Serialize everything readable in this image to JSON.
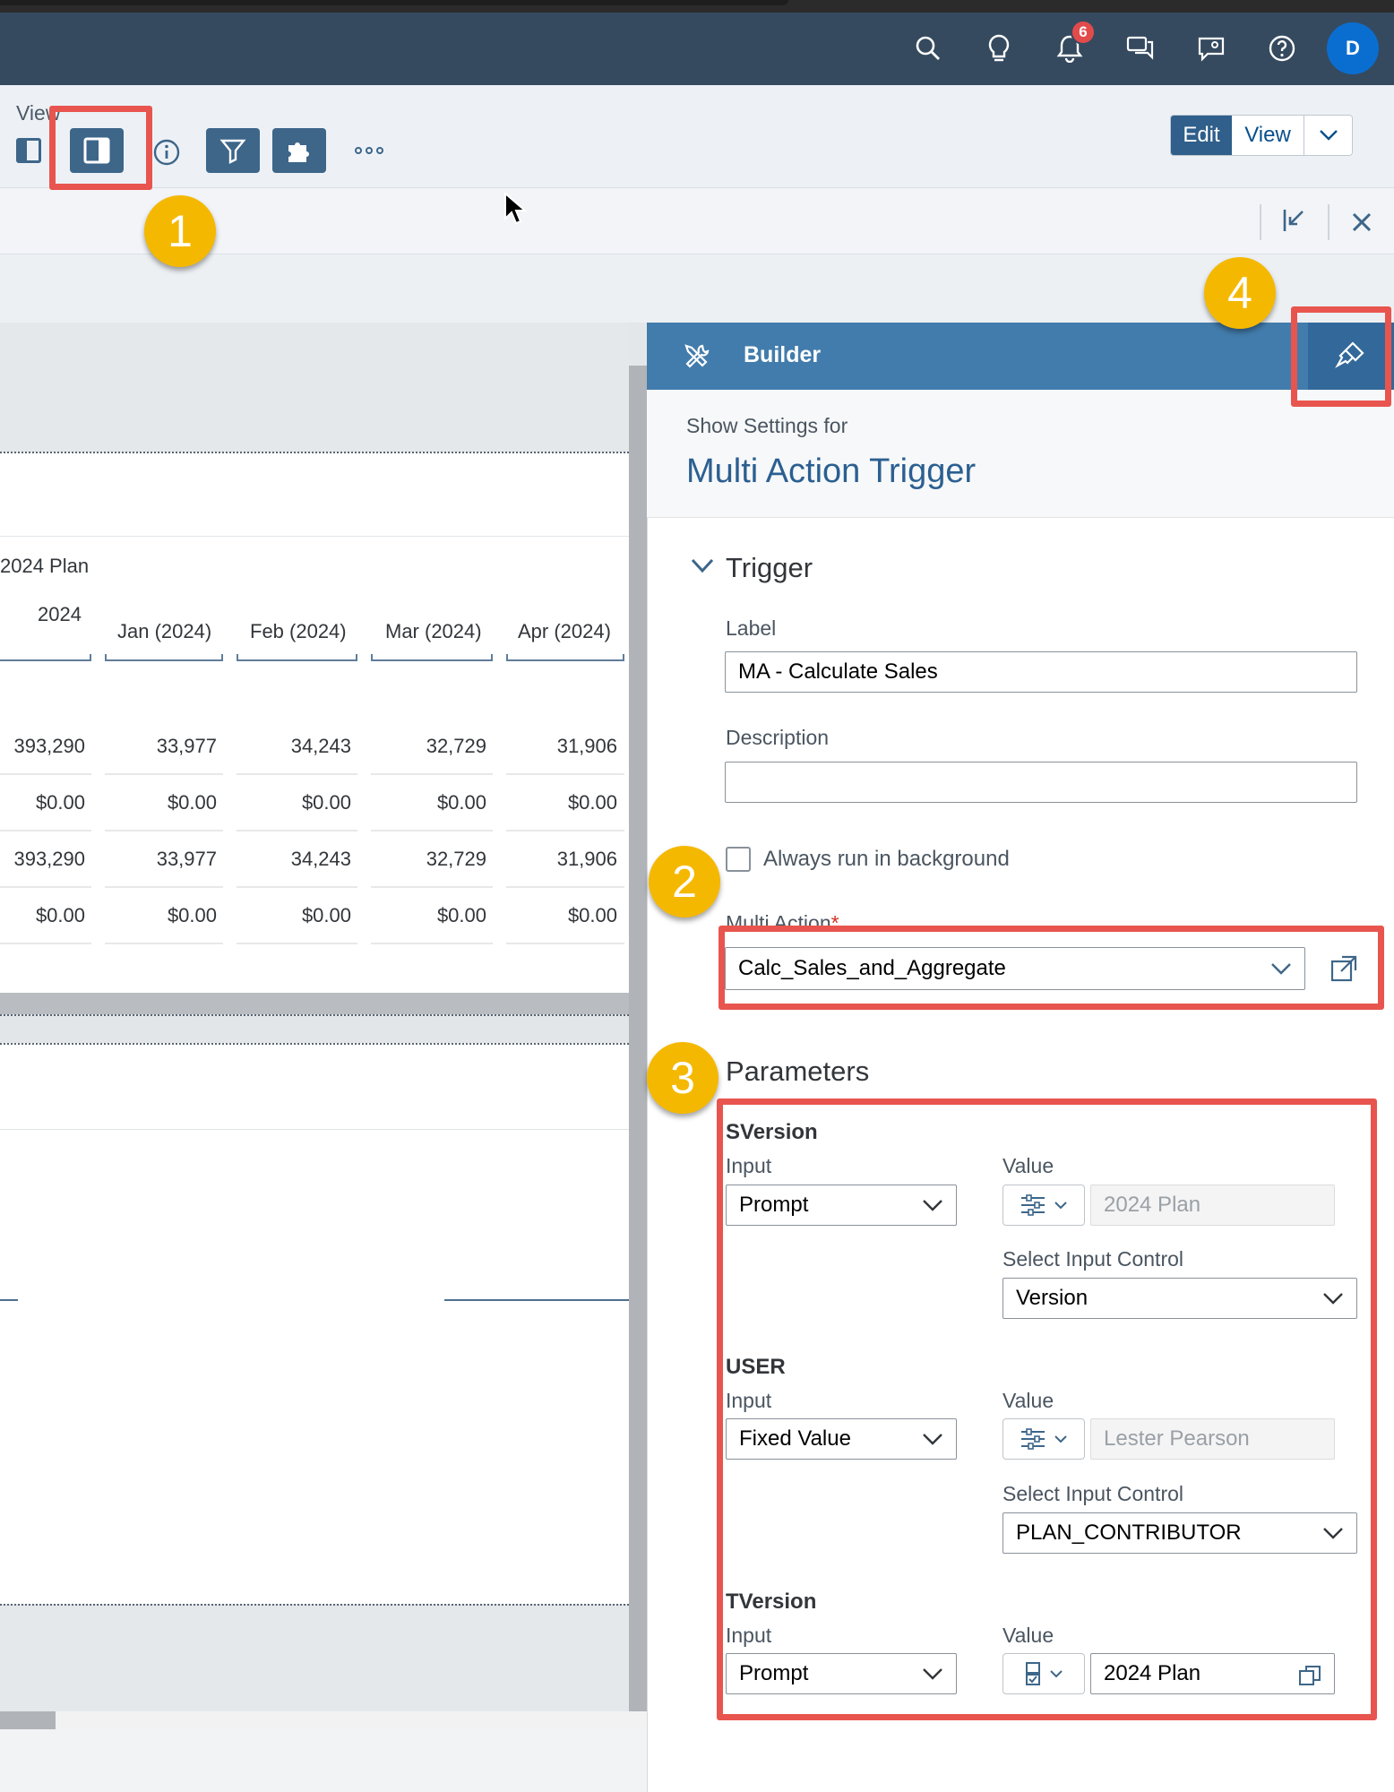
{
  "shell": {
    "notification_count": "6",
    "avatar_initial": "D"
  },
  "toolbar": {
    "view_label": "View",
    "edit_label": "Edit",
    "view_btn_label": "View"
  },
  "table": {
    "version_label": "2024 Plan",
    "columns": [
      "2024",
      "Jan (2024)",
      "Feb (2024)",
      "Mar (2024)",
      "Apr (2024)"
    ],
    "rows": [
      [
        "393,290",
        "33,977",
        "34,243",
        "32,729",
        "31,906"
      ],
      [
        "$0.00",
        "$0.00",
        "$0.00",
        "$0.00",
        "$0.00"
      ],
      [
        "393,290",
        "33,977",
        "34,243",
        "32,729",
        "31,906"
      ],
      [
        "$0.00",
        "$0.00",
        "$0.00",
        "$0.00",
        "$0.00"
      ]
    ]
  },
  "builder": {
    "title": "Builder",
    "show_settings_for": "Show Settings for",
    "object_name": "Multi Action Trigger",
    "trigger_section": "Trigger",
    "label_field": "Label",
    "label_value": "MA - Calculate Sales",
    "description_field": "Description",
    "description_value": "",
    "always_bg": "Always run in background",
    "multi_action_label": "Multi Action",
    "multi_action_required": "*",
    "multi_action_value": "Calc_Sales_and_Aggregate",
    "parameters_section": "Parameters",
    "params": [
      {
        "name": "SVersion",
        "input_label": "Input",
        "input_value": "Prompt",
        "value_label": "Value",
        "value_text": "2024 Plan",
        "select_ic_label": "Select Input Control",
        "select_ic_value": "Version"
      },
      {
        "name": "USER",
        "input_label": "Input",
        "input_value": "Fixed Value",
        "value_label": "Value",
        "value_text": "Lester Pearson",
        "select_ic_label": "Select Input Control",
        "select_ic_value": "PLAN_CONTRIBUTOR"
      },
      {
        "name": "TVersion",
        "input_label": "Input",
        "input_value": "Prompt",
        "value_label": "Value",
        "value_text": "2024 Plan"
      }
    ]
  },
  "steps": [
    "1",
    "2",
    "3",
    "4"
  ],
  "colors": {
    "shell": "#354a5f",
    "panel_header": "#427cac",
    "highlight": "#e8554e",
    "step_badge": "#f5b800"
  },
  "icons": [
    "search-icon",
    "lightbulb-icon",
    "bell-icon",
    "chat-icon",
    "feedback-icon",
    "help-icon",
    "panel-left-icon",
    "panel-right-icon",
    "info-icon",
    "filter-icon",
    "puzzle-icon",
    "more-icon",
    "chevron-down-icon",
    "collapse-icon",
    "close-icon",
    "tools-icon",
    "styling-brush-icon",
    "external-link-icon",
    "value-help-icon",
    "copy-icon"
  ]
}
